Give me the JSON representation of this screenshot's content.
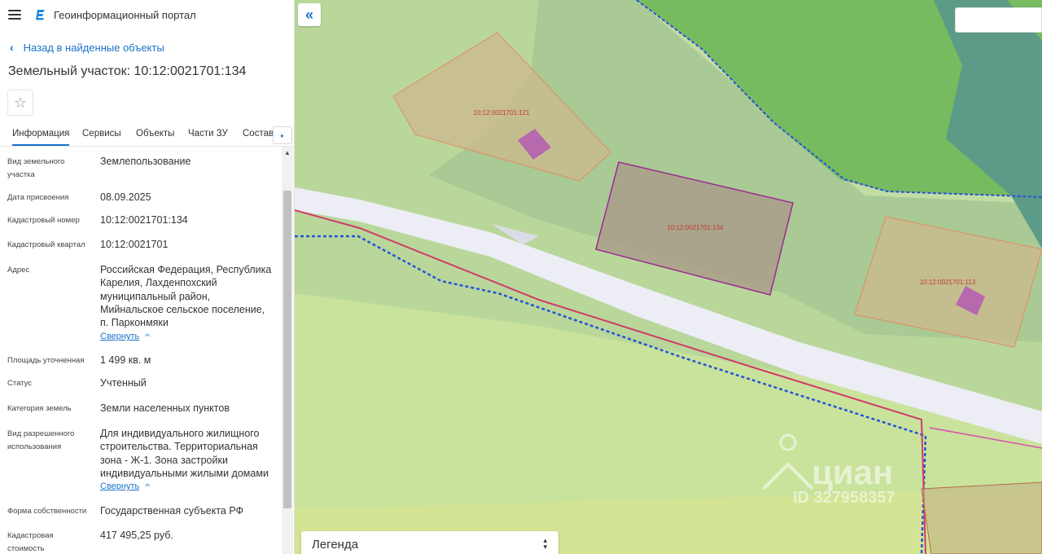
{
  "app": {
    "title": "Геоинформационный портал"
  },
  "nav": {
    "back_label": "Назад в найденные объекты"
  },
  "page": {
    "title": "Земельный участок: 10:12:0021701:134"
  },
  "tabs": [
    {
      "label": "Информация",
      "active": true
    },
    {
      "label": "Сервисы"
    },
    {
      "label": "Объекты"
    },
    {
      "label": "Части ЗУ"
    },
    {
      "label": "Состав"
    }
  ],
  "fields": [
    {
      "label": "Вид земельного участка",
      "value": "Землепользование"
    },
    {
      "label": "Дата присвоения",
      "value": "08.09.2025"
    },
    {
      "label": "Кадастровый номер",
      "value": "10:12:0021701:134"
    },
    {
      "label": "Кадастровый квартал",
      "value": "10:12:0021701"
    },
    {
      "label": "Адрес",
      "value": "Российская Федерация, Республика Карелия, Лахденпохский муниципальный район, Мийнальское сельское поселение, п. Парконмяки",
      "toggle": "Свернуть"
    },
    {
      "label": "Площадь уточненная",
      "value": "1 499 кв. м"
    },
    {
      "label": "Статус",
      "value": "Учтенный"
    },
    {
      "label": "Категория земель",
      "value": "Земли населенных пунктов"
    },
    {
      "label": "Вид разрешенного использования",
      "value": "Для индивидуального жилищного строительства. Территориальная зона - Ж-1. Зона застройки индивидуальными жилыми домами",
      "toggle": "Свернуть"
    },
    {
      "label": "Форма собственности",
      "value": "Государственная субъекта РФ"
    },
    {
      "label": "Кадастровая стоимость",
      "value": "417 495,25 руб."
    }
  ],
  "map": {
    "parcels": [
      {
        "label": "10:12:0021701:121"
      },
      {
        "label": "10:12:0021701:134",
        "selected": true
      },
      {
        "label": "10:12:0021701:113"
      }
    ],
    "watermark": {
      "brand": "циан",
      "id": "ID 327958357"
    },
    "legend_label": "Легенда",
    "colors": {
      "meadow": "#c2dda3",
      "forest": "#76bb5f",
      "water": "#5b9b88",
      "road": "#ededf5",
      "parcel_fill": "#cdb88f",
      "parcel_stroke": "#e38d5e",
      "selected_fill": "#a99e8a",
      "selected_stroke": "#9b2a91",
      "building": "#b769ad",
      "boundary_blue": "#2853d6",
      "boundary_red": "#d23a6a"
    }
  }
}
